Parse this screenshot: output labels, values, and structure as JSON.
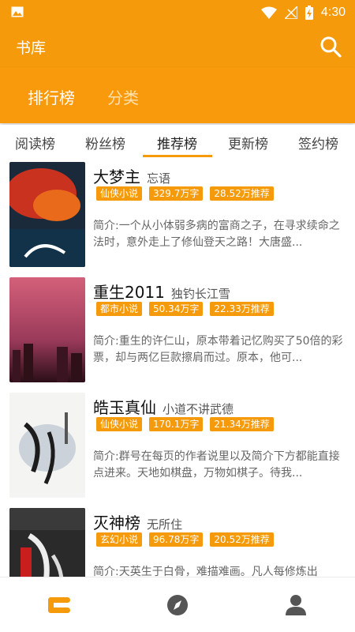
{
  "statusbar": {
    "time": "4:30",
    "icons": [
      "image-icon",
      "wifi-icon",
      "signal-icon",
      "battery-icon"
    ]
  },
  "appbar": {
    "title": "书库",
    "search_icon": "search-icon"
  },
  "tabs": {
    "active": "排行榜",
    "inactive": "分类"
  },
  "subtabs": [
    "阅读榜",
    "粉丝榜",
    "推荐榜",
    "更新榜",
    "签约榜"
  ],
  "selected_subtab": "推荐榜",
  "books": [
    {
      "title": "大梦主",
      "author": "忘语",
      "tags": [
        "仙侠小说",
        "329.7万字",
        "28.52万推荐"
      ],
      "desc": "简介:一个从小体弱多病的富商之子，在寻求续命之法时，意外走上了修仙登天之路！大唐盛..."
    },
    {
      "title": "重生2011",
      "author": "独钓长江雪",
      "tags": [
        "都市小说",
        "50.34万字",
        "22.33万推荐"
      ],
      "desc": "简介:重生的许仁山，原本带着记忆购买了50倍的彩票，却与两亿巨款擦肩而过。原本，他可..."
    },
    {
      "title": "皓玉真仙",
      "author": "小道不讲武德",
      "tags": [
        "仙侠小说",
        "170.1万字",
        "21.34万推荐"
      ],
      "desc": "简介:群号在每页的作者说里以及简介下方都能直接点进来。天地如棋盘，万物如棋子。待我..."
    },
    {
      "title": "灭神榜",
      "author": "无所住",
      "tags": [
        "玄幻小说",
        "96.78万字",
        "20.52万推荐"
      ],
      "desc": "简介:天英生于白骨，难描难画。凡人每修炼出"
    }
  ],
  "bottom_nav": [
    "bookshelf-icon",
    "discover-compass-icon",
    "profile-icon"
  ],
  "colors": {
    "accent": "#F59A0B",
    "tab_inactive": "#FFE1B0"
  }
}
